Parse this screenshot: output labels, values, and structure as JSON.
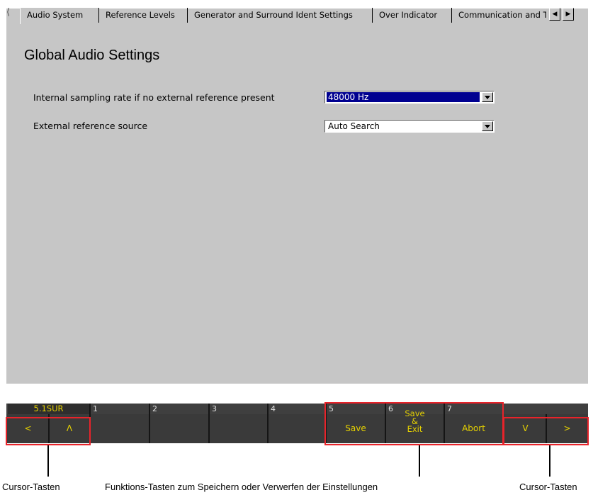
{
  "tabs": [
    {
      "label": "Audio System",
      "active": true
    },
    {
      "label": "Reference Levels",
      "active": false
    },
    {
      "label": "Generator and Surround Ident Settings",
      "active": false
    },
    {
      "label": "Over Indicator",
      "active": false
    },
    {
      "label": "Communication and Ti",
      "active": false
    }
  ],
  "page": {
    "title": "Global Audio Settings"
  },
  "settings": [
    {
      "label": "Internal sampling rate if no external reference present",
      "value": "48000 Hz"
    },
    {
      "label": "External reference source",
      "value": "Auto Search"
    }
  ],
  "keybar": {
    "mode": "5.1SUR",
    "cursor_left_label": "<",
    "cursor_up_label": "Λ",
    "numbers": [
      "1",
      "2",
      "3",
      "4",
      "5",
      "6",
      "7"
    ],
    "save_label": "Save",
    "save_exit_lines": [
      "Save",
      "&",
      "Exit"
    ],
    "abort_label": "Abort",
    "cursor_down_label": "V",
    "cursor_right_label": ">"
  },
  "captions": {
    "left": "Cursor-Tasten",
    "middle": "Funktions-Tasten zum Speichern oder Verwerfen der Einstellungen",
    "right": "Cursor-Tasten"
  },
  "colors": {
    "panel": "#c6c6c6",
    "softkey_text": "#e6d200",
    "highlight": "#e8232a",
    "selection": "#000090"
  },
  "icons": {
    "tab_prev": "triangle-left-icon",
    "tab_next": "triangle-right-icon",
    "dropdown": "chevron-down-icon"
  }
}
